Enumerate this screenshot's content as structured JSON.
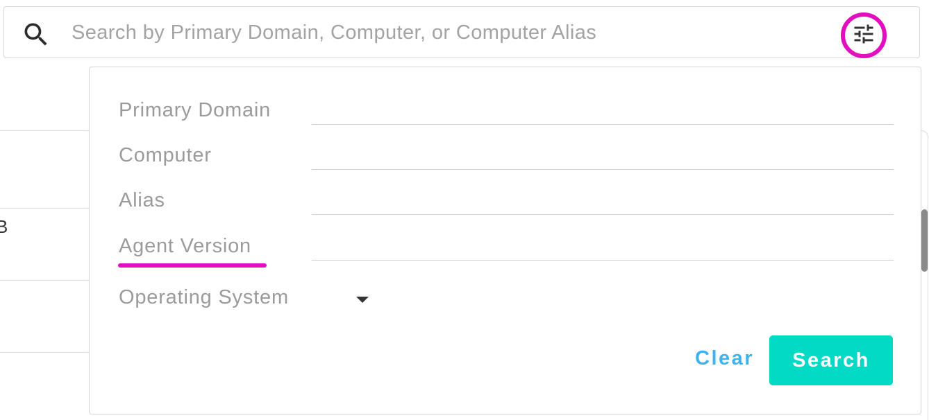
{
  "search": {
    "placeholder": "Search by Primary Domain, Computer, or Computer Alias",
    "value": ""
  },
  "icons": {
    "search": "search-icon",
    "filter_toggle": "tune-sliders-icon",
    "dropdown": "arrow-drop-down-icon"
  },
  "background": {
    "fragment_text": "B"
  },
  "filters": {
    "fields": [
      {
        "label": "Primary Domain",
        "value": ""
      },
      {
        "label": "Computer",
        "value": ""
      },
      {
        "label": "Alias",
        "value": ""
      },
      {
        "label": "Agent Version",
        "value": ""
      }
    ],
    "operating_system": {
      "label": "Operating System",
      "selected": ""
    },
    "clear_label": "Clear",
    "search_label": "Search"
  },
  "colors": {
    "highlight": "#e10fc0",
    "primary_button": "#03dac6",
    "link_button": "#41b2ee",
    "label_gray": "#9b9b9b"
  }
}
